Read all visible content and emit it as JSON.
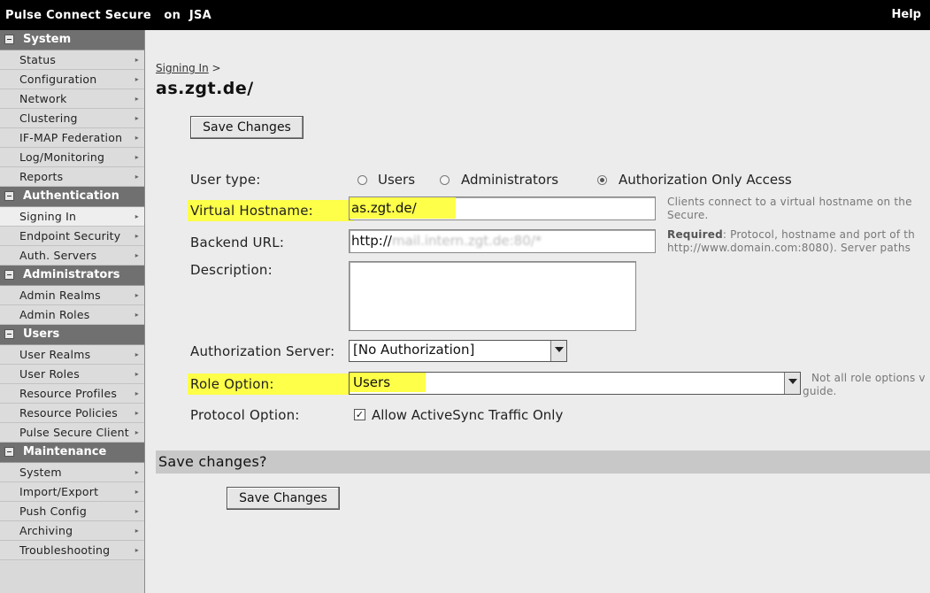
{
  "topbar": {
    "title": "Pulse Connect Secure   on  JSA",
    "help": "Help"
  },
  "sidebar": {
    "sections": [
      {
        "header": "System",
        "items": [
          "Status",
          "Configuration",
          "Network",
          "Clustering",
          "IF-MAP Federation",
          "Log/Monitoring",
          "Reports"
        ]
      },
      {
        "header": "Authentication",
        "items": [
          "Signing In",
          "Endpoint Security",
          "Auth. Servers"
        ]
      },
      {
        "header": "Administrators",
        "items": [
          "Admin Realms",
          "Admin Roles"
        ]
      },
      {
        "header": "Users",
        "items": [
          "User Realms",
          "User Roles",
          "Resource Profiles",
          "Resource Policies",
          "Pulse Secure Client"
        ]
      },
      {
        "header": "Maintenance",
        "items": [
          "System",
          "Import/Export",
          "Push Config",
          "Archiving",
          "Troubleshooting"
        ]
      }
    ],
    "active_item": "Signing In"
  },
  "main": {
    "breadcrumb_link": "Signing In",
    "breadcrumb_sep": ">",
    "title": "as.zgt.de/",
    "save_button": "Save Changes",
    "user_type": {
      "label": "User type:",
      "options": [
        "Users",
        "Administrators",
        "Authorization Only Access"
      ],
      "selected": "Authorization Only Access"
    },
    "virtual_hostname": {
      "label": "Virtual Hostname:",
      "value": "as.zgt.de/",
      "help_line1": "Clients connect to a virtual hostname on the",
      "help_line2": "Secure."
    },
    "backend_url": {
      "label": "Backend URL:",
      "value_prefix": "http://",
      "value_obscured": "mail.intern.zgt.de:80/*",
      "help_bold": "Required",
      "help_line1": ": Protocol, hostname and port of th",
      "help_line2": "http://www.domain.com:8080). Server paths"
    },
    "description": {
      "label": "Description:",
      "value": ""
    },
    "authorization_server": {
      "label": "Authorization Server:",
      "value": "[No Authorization]"
    },
    "role_option": {
      "label": "Role Option:",
      "value": "Users",
      "help_line1": "Not all role options v",
      "help_line2": "guide."
    },
    "protocol_option": {
      "label": "Protocol Option:",
      "checkbox_label": "Allow ActiveSync Traffic Only",
      "checked": true
    },
    "save_section_title": "Save changes?",
    "save_button_bottom": "Save Changes"
  },
  "colors": {
    "highlight": "#fdff48",
    "topbar": "#000000",
    "sidebar_header": "#707070"
  }
}
